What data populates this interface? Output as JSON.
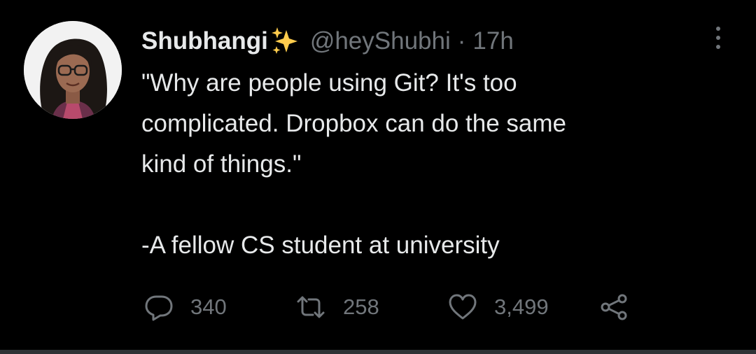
{
  "tweet": {
    "author": {
      "display_name": "Shubhangi",
      "emoji_icon": "sparkles-icon",
      "handle": "@heyShubhi",
      "separator": "·",
      "time": "17h"
    },
    "text": {
      "line1": "\"Why are people using Git? It's too",
      "line2": "complicated. Dropbox can do the same",
      "line3": "kind of things.\"",
      "line4": "-A fellow CS student at university"
    },
    "actions": {
      "replies": "340",
      "retweets": "258",
      "likes": "3,499"
    }
  },
  "colors": {
    "background": "#000000",
    "text": "#e7e9ea",
    "muted": "#71767b",
    "sparkle": "#ffcc4d"
  }
}
